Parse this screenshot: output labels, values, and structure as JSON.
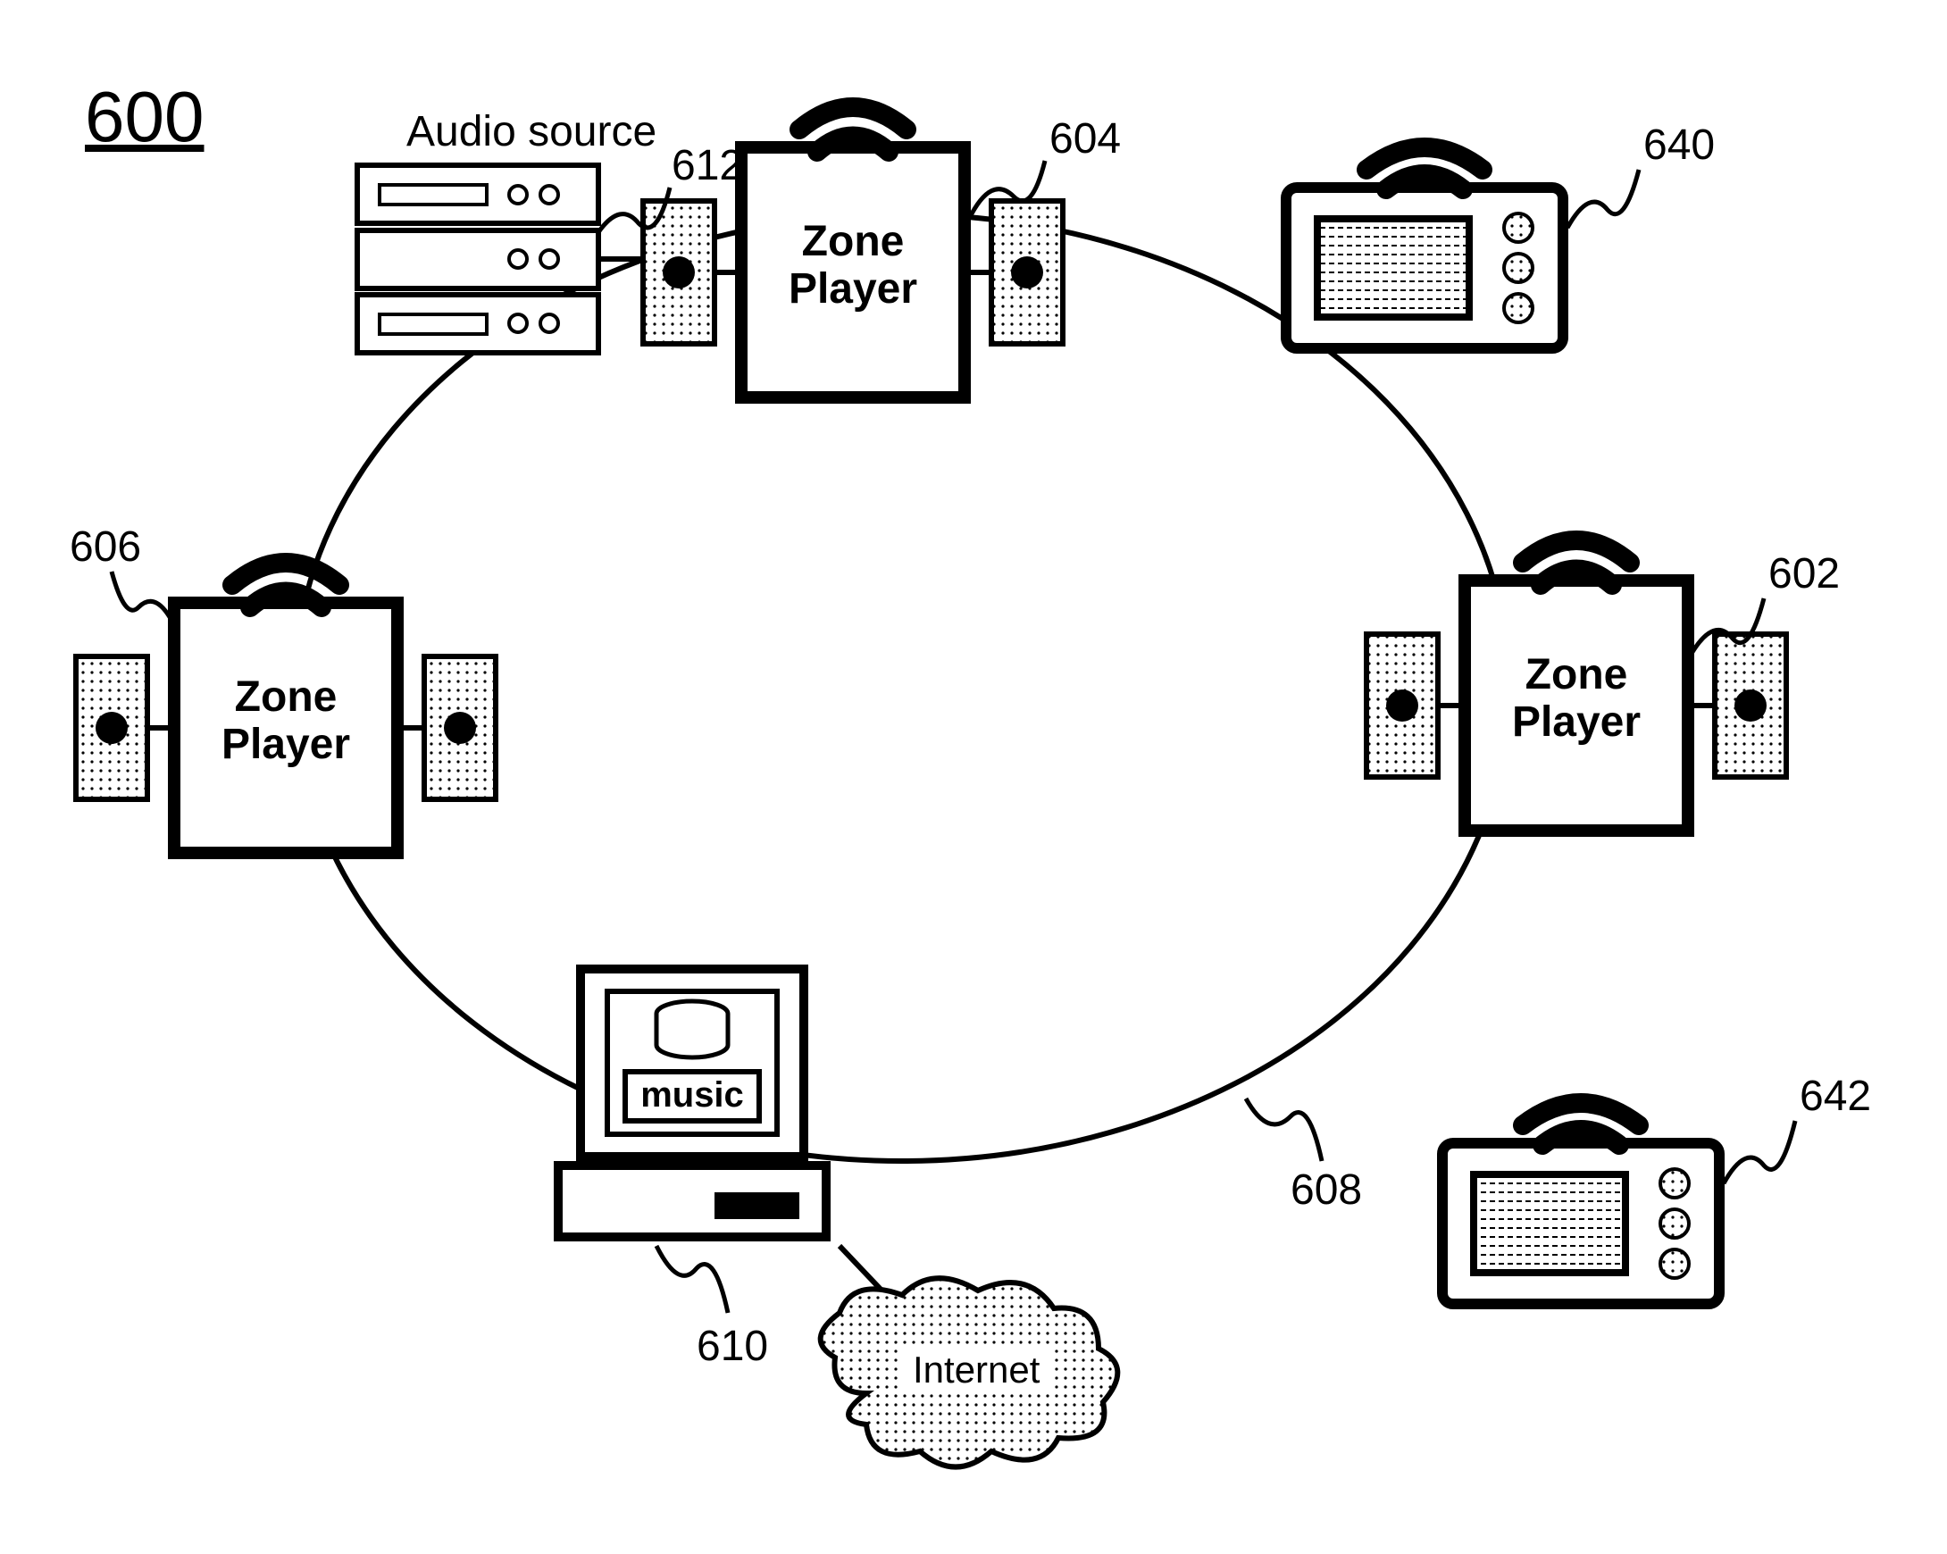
{
  "figure_number": "600",
  "audio_source_label": "Audio source",
  "zone_player_label_top": "Zone",
  "zone_player_label_bottom": "Player",
  "music_label": "music",
  "internet_label": "Internet",
  "refs": {
    "r600": "600",
    "r602": "602",
    "r604": "604",
    "r606": "606",
    "r608": "608",
    "r610": "610",
    "r612": "612",
    "r640": "640",
    "r642": "642"
  }
}
